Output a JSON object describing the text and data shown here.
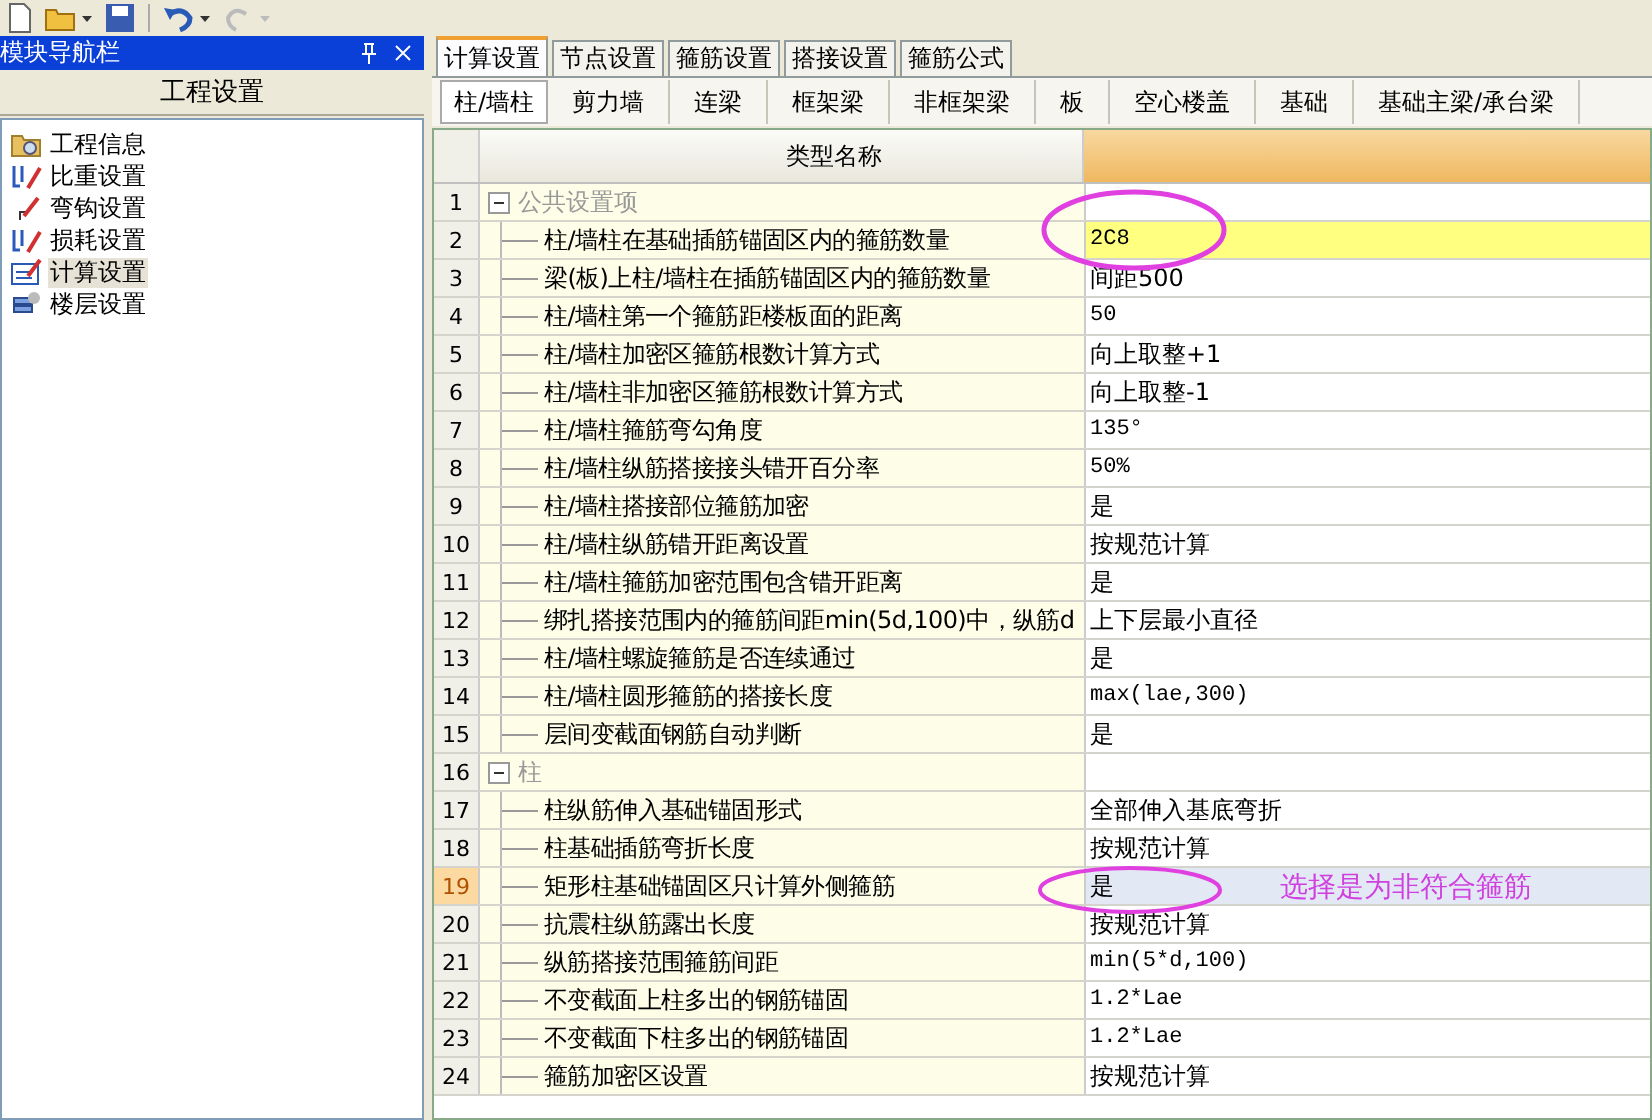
{
  "nav_panel": {
    "title": "模块导航栏",
    "section": "工程设置",
    "items": [
      {
        "label": "工程信息",
        "selected": false
      },
      {
        "label": "比重设置",
        "selected": false
      },
      {
        "label": "弯钩设置",
        "selected": false
      },
      {
        "label": "损耗设置",
        "selected": false
      },
      {
        "label": "计算设置",
        "selected": true
      },
      {
        "label": "楼层设置",
        "selected": false
      }
    ]
  },
  "tabs": [
    {
      "label": "计算设置",
      "selected": true
    },
    {
      "label": "节点设置",
      "selected": false
    },
    {
      "label": "箍筋设置",
      "selected": false
    },
    {
      "label": "搭接设置",
      "selected": false
    },
    {
      "label": "箍筋公式",
      "selected": false
    }
  ],
  "subtabs": [
    {
      "label": "柱/墙柱",
      "selected": true
    },
    {
      "label": "剪力墙",
      "selected": false
    },
    {
      "label": "连梁",
      "selected": false
    },
    {
      "label": "框架梁",
      "selected": false
    },
    {
      "label": "非框架梁",
      "selected": false
    },
    {
      "label": "板",
      "selected": false
    },
    {
      "label": "空心楼盖",
      "selected": false
    },
    {
      "label": "基础",
      "selected": false
    },
    {
      "label": "基础主梁/承台梁",
      "selected": false
    }
  ],
  "table": {
    "columns": [
      "类型名称"
    ],
    "rows": [
      {
        "num": "1",
        "kind": "group",
        "name": "公共设置项",
        "value": "",
        "selected": false,
        "highlighted": false
      },
      {
        "num": "2",
        "kind": "item",
        "name": "柱/墙柱在基础插筋锚固区内的箍筋数量",
        "value": "2C8",
        "selected": false,
        "highlighted": true
      },
      {
        "num": "3",
        "kind": "item",
        "name": "梁(板)上柱/墙柱在插筋锚固区内的箍筋数量",
        "value": "间距500",
        "selected": false,
        "highlighted": false
      },
      {
        "num": "4",
        "kind": "item",
        "name": "柱/墙柱第一个箍筋距楼板面的距离",
        "value": "50",
        "selected": false,
        "highlighted": false
      },
      {
        "num": "5",
        "kind": "item",
        "name": "柱/墙柱加密区箍筋根数计算方式",
        "value": "向上取整+1",
        "selected": false,
        "highlighted": false
      },
      {
        "num": "6",
        "kind": "item",
        "name": "柱/墙柱非加密区箍筋根数计算方式",
        "value": "向上取整-1",
        "selected": false,
        "highlighted": false
      },
      {
        "num": "7",
        "kind": "item",
        "name": "柱/墙柱箍筋弯勾角度",
        "value": "135°",
        "selected": false,
        "highlighted": false
      },
      {
        "num": "8",
        "kind": "item",
        "name": "柱/墙柱纵筋搭接接头错开百分率",
        "value": "50%",
        "selected": false,
        "highlighted": false
      },
      {
        "num": "9",
        "kind": "item",
        "name": "柱/墙柱搭接部位箍筋加密",
        "value": "是",
        "selected": false,
        "highlighted": false
      },
      {
        "num": "10",
        "kind": "item",
        "name": "柱/墙柱纵筋错开距离设置",
        "value": "按规范计算",
        "selected": false,
        "highlighted": false
      },
      {
        "num": "11",
        "kind": "item",
        "name": "柱/墙柱箍筋加密范围包含错开距离",
        "value": "是",
        "selected": false,
        "highlighted": false
      },
      {
        "num": "12",
        "kind": "item",
        "name": "绑扎搭接范围内的箍筋间距min(5d,100)中，纵筋d",
        "value": "上下层最小直径",
        "selected": false,
        "highlighted": false
      },
      {
        "num": "13",
        "kind": "item",
        "name": "柱/墙柱螺旋箍筋是否连续通过",
        "value": "是",
        "selected": false,
        "highlighted": false
      },
      {
        "num": "14",
        "kind": "item",
        "name": "柱/墙柱圆形箍筋的搭接长度",
        "value": "max(lae,300)",
        "selected": false,
        "highlighted": false
      },
      {
        "num": "15",
        "kind": "item",
        "name": "层间变截面钢筋自动判断",
        "value": "是",
        "selected": false,
        "highlighted": false
      },
      {
        "num": "16",
        "kind": "group",
        "name": "柱",
        "value": "",
        "selected": false,
        "highlighted": false
      },
      {
        "num": "17",
        "kind": "item",
        "name": "柱纵筋伸入基础锚固形式",
        "value": "全部伸入基底弯折",
        "selected": false,
        "highlighted": false
      },
      {
        "num": "18",
        "kind": "item",
        "name": "柱基础插筋弯折长度",
        "value": "按规范计算",
        "selected": false,
        "highlighted": false
      },
      {
        "num": "19",
        "kind": "item",
        "name": "矩形柱基础锚固区只计算外侧箍筋",
        "value": "是",
        "selected": true,
        "highlighted": false
      },
      {
        "num": "20",
        "kind": "item",
        "name": "抗震柱纵筋露出长度",
        "value": "按规范计算",
        "selected": false,
        "highlighted": false
      },
      {
        "num": "21",
        "kind": "item",
        "name": "纵筋搭接范围箍筋间距",
        "value": "min(5*d,100)",
        "selected": false,
        "highlighted": false
      },
      {
        "num": "22",
        "kind": "item",
        "name": "不变截面上柱多出的钢筋锚固",
        "value": "1.2*Lae",
        "selected": false,
        "highlighted": false
      },
      {
        "num": "23",
        "kind": "item",
        "name": "不变截面下柱多出的钢筋锚固",
        "value": "1.2*Lae",
        "selected": false,
        "highlighted": false
      },
      {
        "num": "24",
        "kind": "item",
        "name": "箍筋加密区设置",
        "value": "按规范计算",
        "selected": false,
        "highlighted": false
      }
    ]
  },
  "annotation": {
    "text": "选择是为非符合箍筋"
  }
}
